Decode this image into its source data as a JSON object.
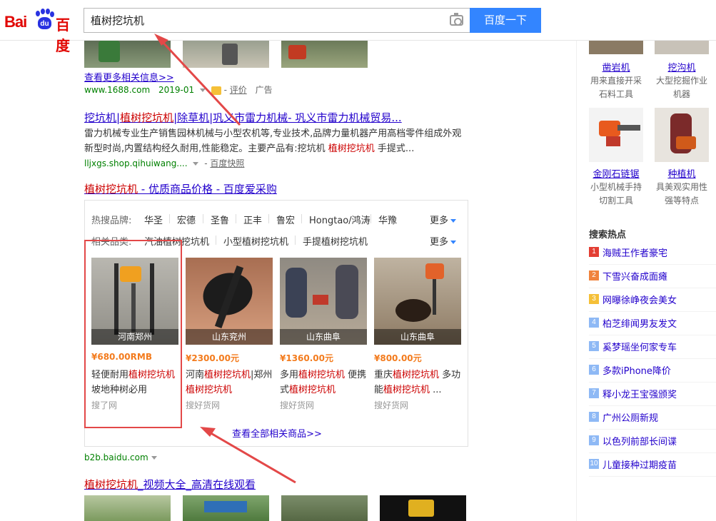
{
  "logo": {
    "left": "Bai",
    "paw": "du",
    "right": "百度"
  },
  "search": {
    "query": "植树挖坑机",
    "button": "百度一下"
  },
  "result_top": {
    "see_more": "查看更多相关信息>>",
    "url": "www.1688.com",
    "date": "2019-01",
    "rating_link": "评价",
    "ad_label": "广告"
  },
  "result1": {
    "title_a": "挖坑机|",
    "title_em": "植树挖坑机",
    "title_b": "|除草机|巩义市雷力机械- 巩义市雷力机械贸易...",
    "desc_a": "雷力机械专业生产销售园林机械与小型农机等,专业技术,品牌力量机器产用高档零件组成外观新型时尚,内置结构经久耐用,性能稳定。主要产品有:挖坑机 ",
    "desc_em": "植树挖坑机",
    "desc_b": " 手提式...",
    "url": "lljxgs.shop.qihuiwang....",
    "snapshot": "百度快照"
  },
  "result2": {
    "title_em": "植树挖坑机",
    "title_b": " - 优质商品价格 - 百度爱采购",
    "hot_brands_label": "热搜品牌:",
    "brands": [
      "华圣",
      "宏德",
      "圣鲁",
      "正丰",
      "鲁宏",
      "Hongtao/鸿涛",
      "华豫"
    ],
    "related_label": "相关品类:",
    "related": [
      "汽油植树挖坑机",
      "小型植树挖坑机",
      "手提植树挖坑机"
    ],
    "more": "更多",
    "products": [
      {
        "loc": "河南郑州",
        "price": "¥680.00RMB",
        "name_a": "轻便耐用",
        "name_em": "植树挖坑机",
        "name_b": "坡地种树必用",
        "src": "搜了网"
      },
      {
        "loc": "山东兖州",
        "price": "¥2300.00元",
        "name_a": "河南",
        "name_em": "植树挖坑机",
        "name_b": "|郑州",
        "name_em2": "植树挖坑机",
        "src": "搜好货网"
      },
      {
        "loc": "山东曲阜",
        "price": "¥1360.00元",
        "name_a": "多用",
        "name_em": "植树挖坑机",
        "name_b": " 便携式",
        "name_em2": "植树挖坑机",
        "src": "搜好货网"
      },
      {
        "loc": "山东曲阜",
        "price": "¥800.00元",
        "name_a": "重庆",
        "name_em": "植树挖坑机",
        "name_b": " 多功能",
        "name_em2": "植树挖坑机",
        "name_c": " ...",
        "src": "搜好货网"
      }
    ],
    "view_all": "查看全部相关商品>>",
    "url": "b2b.baidu.com"
  },
  "result3": {
    "title_em": "植树挖坑机",
    "title_b": "_视频大全_高清在线观看"
  },
  "right_tiles": [
    {
      "name": "凿岩机",
      "desc": "用来直接开采石料工具"
    },
    {
      "name": "挖沟机",
      "desc": "大型挖掘作业机器"
    },
    {
      "name": "金刚石链锯",
      "desc": "小型机械手持切割工具"
    },
    {
      "name": "种植机",
      "desc": "具美观实用性强等特点"
    }
  ],
  "hot": {
    "title": "搜索热点",
    "items": [
      {
        "num": "1",
        "text": "海贼王作者豪宅",
        "color": "#e33e33"
      },
      {
        "num": "2",
        "text": "下雪兴奋成面瘫",
        "color": "#f0833d"
      },
      {
        "num": "3",
        "text": "网曝徐峥夜会美女",
        "color": "#f5c038"
      },
      {
        "num": "4",
        "text": "柏芝绯闻男友发文",
        "color": "#8eb9f5"
      },
      {
        "num": "5",
        "text": "奚梦瑶坐何家专车",
        "color": "#8eb9f5"
      },
      {
        "num": "6",
        "text": "多款iPhone降价",
        "color": "#8eb9f5"
      },
      {
        "num": "7",
        "text": "释小龙王宝强颁奖",
        "color": "#8eb9f5"
      },
      {
        "num": "8",
        "text": "广州公厕新规",
        "color": "#8eb9f5"
      },
      {
        "num": "9",
        "text": "以色列前部长间谍",
        "color": "#8eb9f5"
      },
      {
        "num": "10",
        "text": "儿童接种过期疫苗",
        "color": "#8eb9f5"
      }
    ]
  },
  "colors": {
    "accent": "#3385ff",
    "title_link": "#2200cc",
    "highlight": "#cc0000",
    "url_green": "#008000",
    "price": "#f37b1d",
    "annotation_red": "#e34848"
  }
}
